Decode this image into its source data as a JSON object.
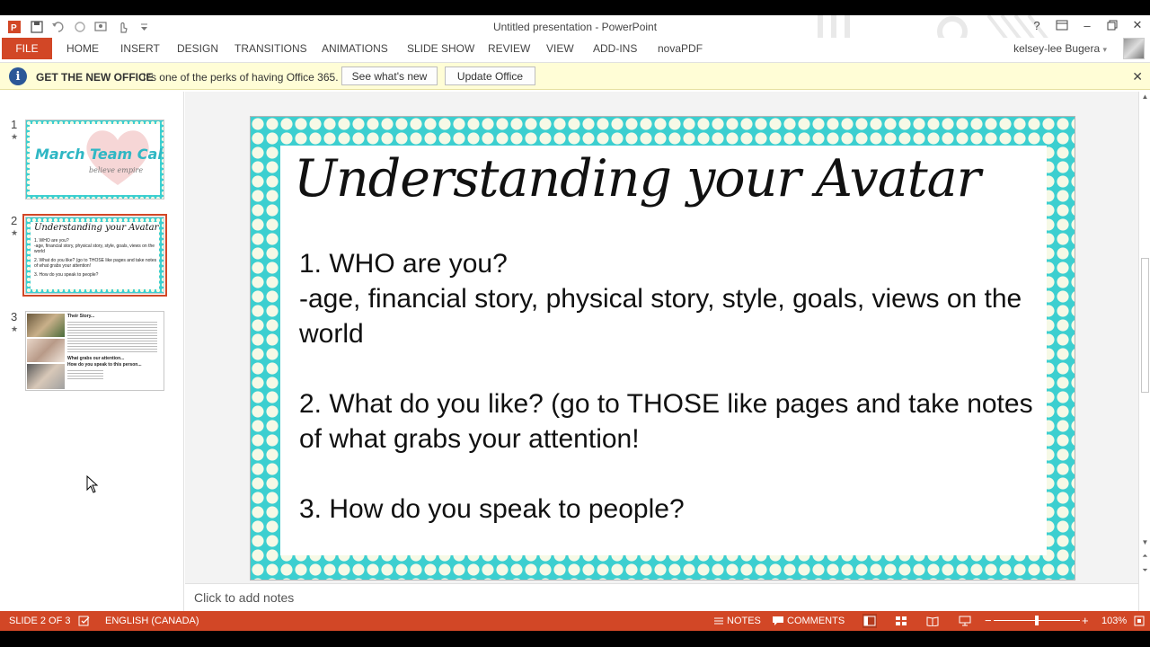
{
  "window": {
    "title": "Untitled presentation - PowerPoint",
    "help_label": "?",
    "minimize_label": "–",
    "close_label": "✕"
  },
  "ribbon": {
    "file_label": "FILE",
    "tabs": [
      "HOME",
      "INSERT",
      "DESIGN",
      "TRANSITIONS",
      "ANIMATIONS",
      "SLIDE SHOW",
      "REVIEW",
      "VIEW",
      "ADD-INS",
      "novaPDF"
    ],
    "user_name": "kelsey-lee Bugera",
    "user_menu_arrow": "▾"
  },
  "message_bar": {
    "icon": "i",
    "title": "GET THE NEW OFFICE",
    "text": "It's one of the perks of having Office 365.",
    "btn_whats_new": "See what's new",
    "btn_update": "Update Office",
    "close": "✕"
  },
  "thumbnails": [
    {
      "number": "1",
      "star": "★",
      "title": "March Team Call",
      "subtitle": "believe empire"
    },
    {
      "number": "2",
      "star": "★",
      "title": "Understanding your Avatar",
      "lines": [
        "1. WHO are you?",
        "-age, financial story, physical story, style, goals, views on the world",
        "2. What do you like? (go to THOSE like pages and take notes of what grabs your attention!",
        "3. How do you speak to people?"
      ]
    },
    {
      "number": "3",
      "star": "★",
      "heading1": "Their Story...",
      "heading2": "What grabs our attention...",
      "heading3": "How do you speak to this person..."
    }
  ],
  "slide": {
    "title": "Understanding your Avatar",
    "line1": "1. WHO are you?",
    "line2": "-age, financial story, physical story, style, goals, views on the world",
    "line3": "2. What do you like? (go to THOSE like pages and take notes of what grabs your attention!",
    "line4": "3. How do you speak to people?"
  },
  "notes": {
    "placeholder": "Click to add notes"
  },
  "statusbar": {
    "slide_info": "SLIDE 2 OF 3",
    "language": "ENGLISH (CANADA)",
    "notes_label": "NOTES",
    "comments_label": "COMMENTS",
    "zoom": "103%",
    "zoom_minus": "−",
    "zoom_plus": "+"
  },
  "colors": {
    "accent": "#d24726",
    "slide_border": "#3ccfd0",
    "message_bar": "#fffdd6"
  }
}
